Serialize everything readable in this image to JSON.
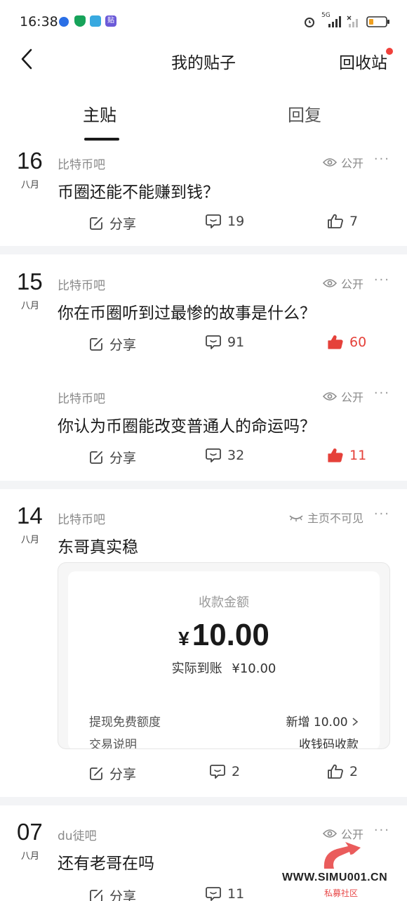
{
  "status_bar": {
    "time": "16:38",
    "network": "5G",
    "app_badge": "贴",
    "colors": {
      "blue_dot": "#2a6fe6",
      "shield": "#17a35a",
      "book": "#38a9e0",
      "badge": "#6b5ad8"
    }
  },
  "navbar": {
    "title": "我的贴子",
    "recycle_label": "回收站",
    "reddot_color": "#f0413b"
  },
  "tabs": [
    {
      "label": "主贴",
      "active": true
    },
    {
      "label": "回复",
      "active": false
    }
  ],
  "posts": [
    {
      "day": "16",
      "month": "八月",
      "forum": "比特币吧",
      "visibility": "公开",
      "title": "币圈还能不能赚到钱？",
      "share_label": "分享",
      "comments": "19",
      "likes": "7",
      "liked": false
    },
    {
      "day": "15",
      "month": "八月",
      "forum": "比特币吧",
      "visibility": "公开",
      "title": "你在币圈听到过最惨的故事是什么？",
      "share_label": "分享",
      "comments": "91",
      "likes": "60",
      "liked": true
    },
    {
      "day": "",
      "month": "",
      "forum": "比特币吧",
      "visibility": "公开",
      "title": "你认为币圈能改变普通人的命运吗？",
      "share_label": "分享",
      "comments": "32",
      "likes": "11",
      "liked": true
    },
    {
      "day": "14",
      "month": "八月",
      "forum": "比特币吧",
      "visibility": "主页不可见",
      "title": "东哥真实稳",
      "share_label": "分享",
      "comments": "2",
      "likes": "2",
      "liked": false
    },
    {
      "day": "07",
      "month": "八月",
      "forum": "du徒吧",
      "visibility": "公开",
      "title": "还有老哥在吗",
      "share_label": "分享",
      "comments": "11",
      "likes": "",
      "liked": false
    }
  ],
  "receipt": {
    "header": "收款金额",
    "currency": "¥",
    "amount": "10.00",
    "received_label": "实际到账",
    "received_value": "¥10.00",
    "row1_label": "提现免费额度",
    "row1_value": "新增 10.00",
    "row2_label": "交易说明",
    "row2_value": "收钱码收款"
  },
  "watermark": {
    "site": "WWW.SIMU001.CN",
    "caption": "私募社区"
  },
  "more_symbol": "···",
  "accent_like": "#e5413a"
}
